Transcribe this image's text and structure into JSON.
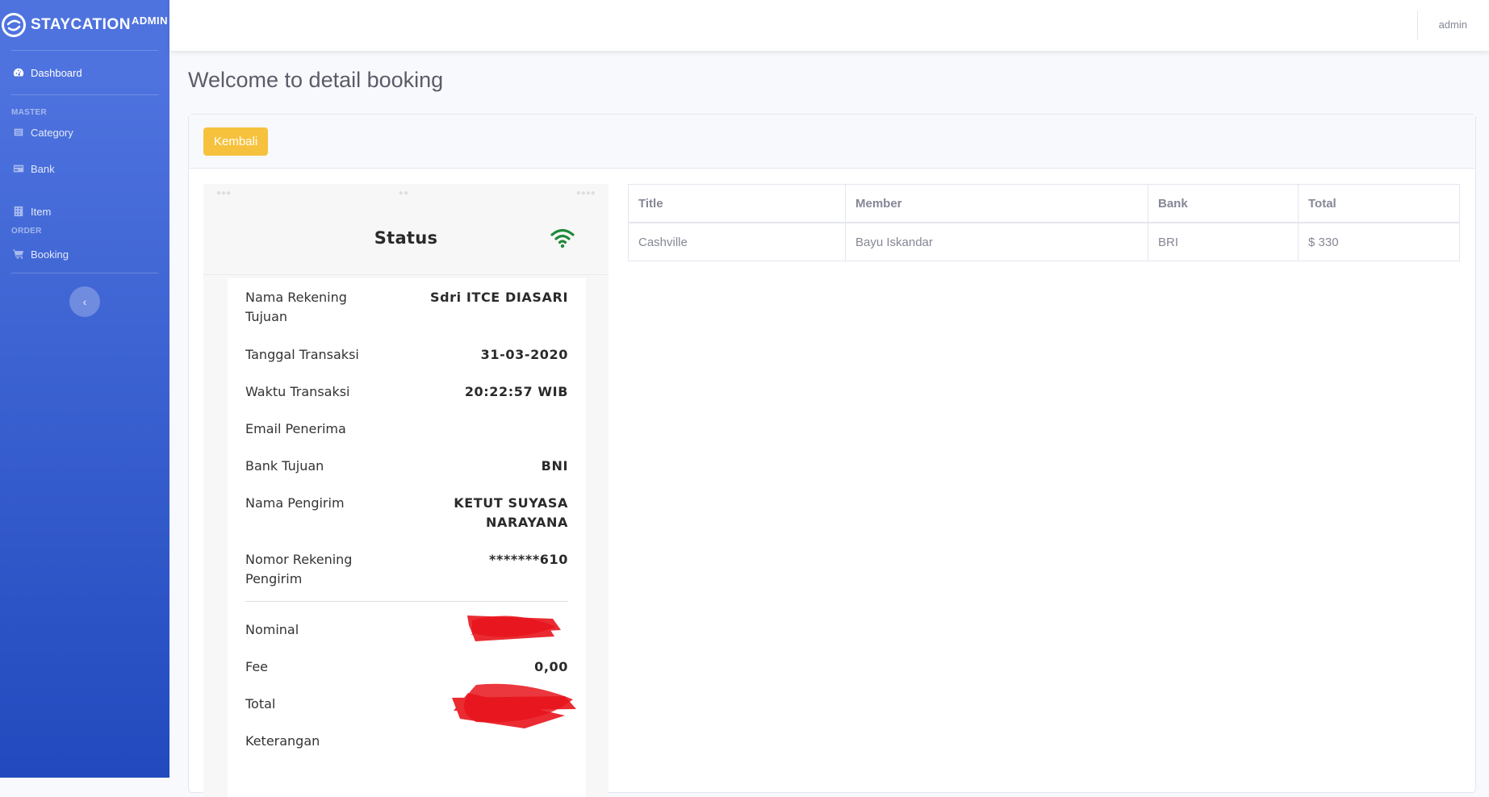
{
  "brand": {
    "name": "STAYCATION",
    "suffix": "ADMIN"
  },
  "sidebar": {
    "dashboard": "Dashboard",
    "heading_master": "MASTER",
    "category": "Category",
    "bank": "Bank",
    "item": "Item",
    "heading_order": "ORDER",
    "booking": "Booking",
    "toggle_icon": "chevron-left-icon"
  },
  "topbar": {
    "user": "admin"
  },
  "page": {
    "title": "Welcome to detail booking",
    "back_button": "Kembali"
  },
  "receipt": {
    "title": "Status",
    "rows": [
      {
        "label": "Nama Rekening Tujuan",
        "value": "Sdri ITCE DIASARI"
      },
      {
        "label": "Tanggal Transaksi",
        "value": "31-03-2020"
      },
      {
        "label": "Waktu Transaksi",
        "value": "20:22:57 WIB"
      },
      {
        "label": "Email Penerima",
        "value": ""
      },
      {
        "label": "Bank Tujuan",
        "value": "BNI"
      },
      {
        "label": "Nama Pengirim",
        "value": "KETUT SUYASA NARAYANA"
      },
      {
        "label": "Nomor Rekening Pengirim",
        "value": "*******610"
      },
      {
        "label": "Nominal",
        "value": ""
      },
      {
        "label": "Fee",
        "value": "0,00"
      },
      {
        "label": "Total",
        "value": ""
      },
      {
        "label": "Keterangan",
        "value": ""
      }
    ]
  },
  "table": {
    "headers": [
      "Title",
      "Member",
      "Bank",
      "Total"
    ],
    "row": [
      "Cashville",
      "Bayu Iskandar",
      "BRI",
      "$ 330"
    ]
  },
  "colors": {
    "sidebar_top": "#4e73df",
    "sidebar_bottom": "#224abe",
    "warning": "#f6c23e",
    "wifi": "#1f8a3a",
    "redaction": "#e8141c"
  }
}
